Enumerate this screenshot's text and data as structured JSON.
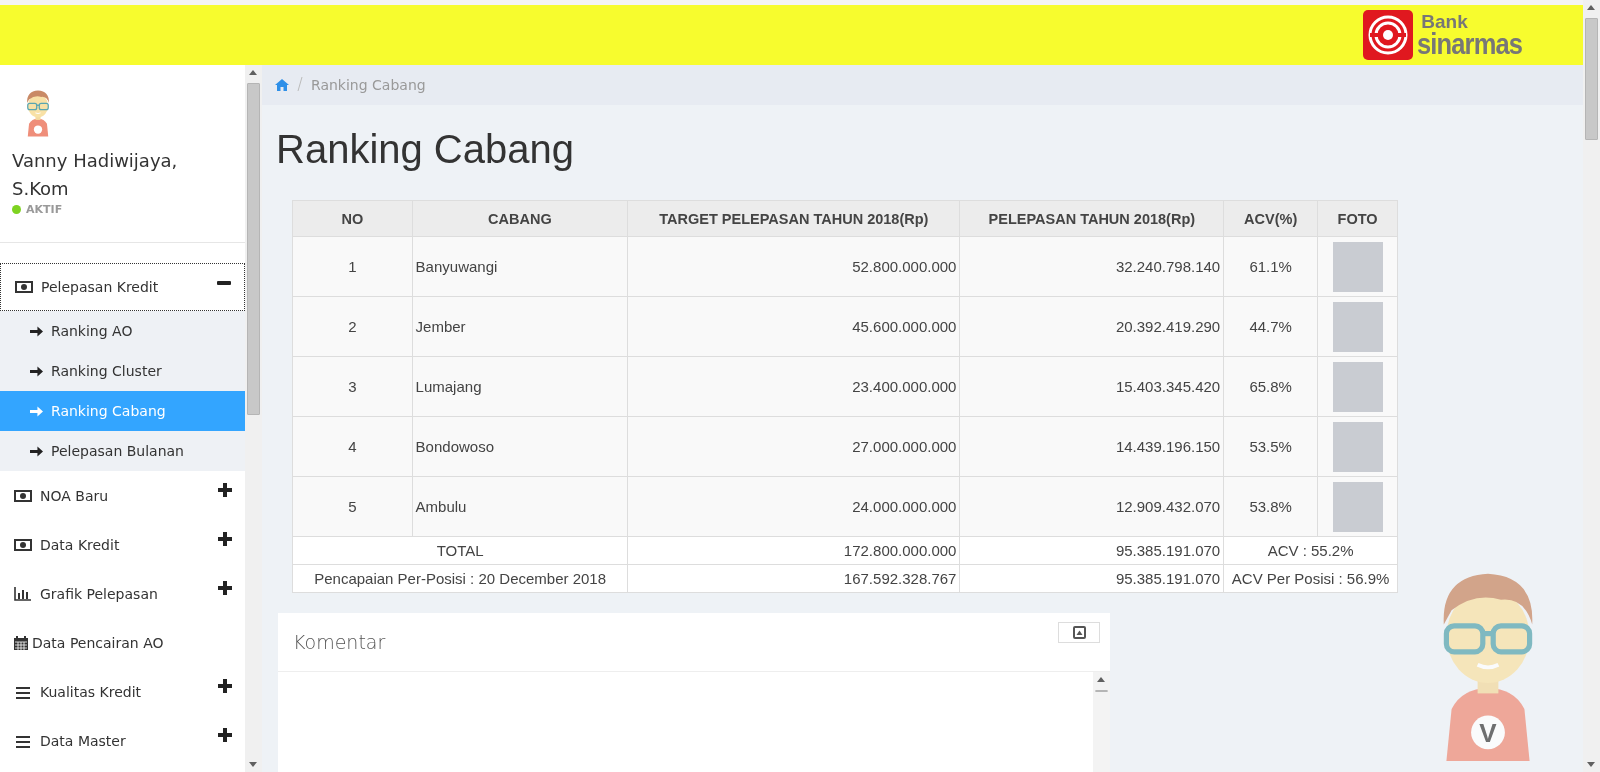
{
  "header": {
    "logo_top": "Bank",
    "logo_bottom": "sinarmas"
  },
  "profile": {
    "name": "Vanny Hadiwijaya, S.Kom",
    "status": "AKTIF",
    "online": true
  },
  "menu": [
    {
      "kind": "group",
      "label": "Pelepasan Kredit",
      "expanded": true,
      "children": [
        {
          "label": "Ranking AO",
          "selected": false
        },
        {
          "label": "Ranking Cluster",
          "selected": false
        },
        {
          "label": "Ranking Cabang",
          "selected": true
        },
        {
          "label": "Pelepasan Bulanan",
          "selected": false
        }
      ]
    },
    {
      "kind": "group",
      "label": "NOA Baru",
      "expanded": false
    },
    {
      "kind": "group",
      "label": "Data Kredit",
      "expanded": false
    },
    {
      "kind": "group",
      "label": "Grafik Pelepasan",
      "expanded": false
    },
    {
      "kind": "link",
      "label": "Data Pencairan AO"
    },
    {
      "kind": "group",
      "label": "Kualitas Kredit",
      "expanded": false
    },
    {
      "kind": "group",
      "label": "Data Master",
      "expanded": false
    }
  ],
  "breadcrumb": [
    "Ranking Cabang"
  ],
  "page_title": "Ranking Cabang",
  "table": {
    "columns": [
      "NO",
      "CABANG",
      "TARGET PELEPASAN TAHUN 2018(Rp)",
      "PELEPASAN TAHUN 2018(Rp)",
      "ACV(%)",
      "FOTO"
    ],
    "rows": [
      {
        "no": "1",
        "cabang": "Banyuwangi",
        "target": "52.800.000.000",
        "pelepasan": "32.240.798.140",
        "acv": "61.1%"
      },
      {
        "no": "2",
        "cabang": "Jember",
        "target": "45.600.000.000",
        "pelepasan": "20.392.419.290",
        "acv": "44.7%"
      },
      {
        "no": "3",
        "cabang": "Lumajang",
        "target": "23.400.000.000",
        "pelepasan": "15.403.345.420",
        "acv": "65.8%"
      },
      {
        "no": "4",
        "cabang": "Bondowoso",
        "target": "27.000.000.000",
        "pelepasan": "14.439.196.150",
        "acv": "53.5%"
      },
      {
        "no": "5",
        "cabang": "Ambulu",
        "target": "24.000.000.000",
        "pelepasan": "12.909.432.070",
        "acv": "53.8%"
      }
    ],
    "footer": [
      {
        "label": "TOTAL",
        "target": "172.800.000.000",
        "pelepasan": "95.385.191.070",
        "acv": "ACV : 55.2%"
      },
      {
        "label": "Pencapaian Per-Posisi : 20 December 2018",
        "target": "167.592.328.767",
        "pelepasan": "95.385.191.070",
        "acv": "ACV Per Posisi : 56.9%"
      }
    ]
  },
  "comment_panel": {
    "title": "Komentar"
  },
  "mascot": {
    "shirt_letter": "V"
  }
}
